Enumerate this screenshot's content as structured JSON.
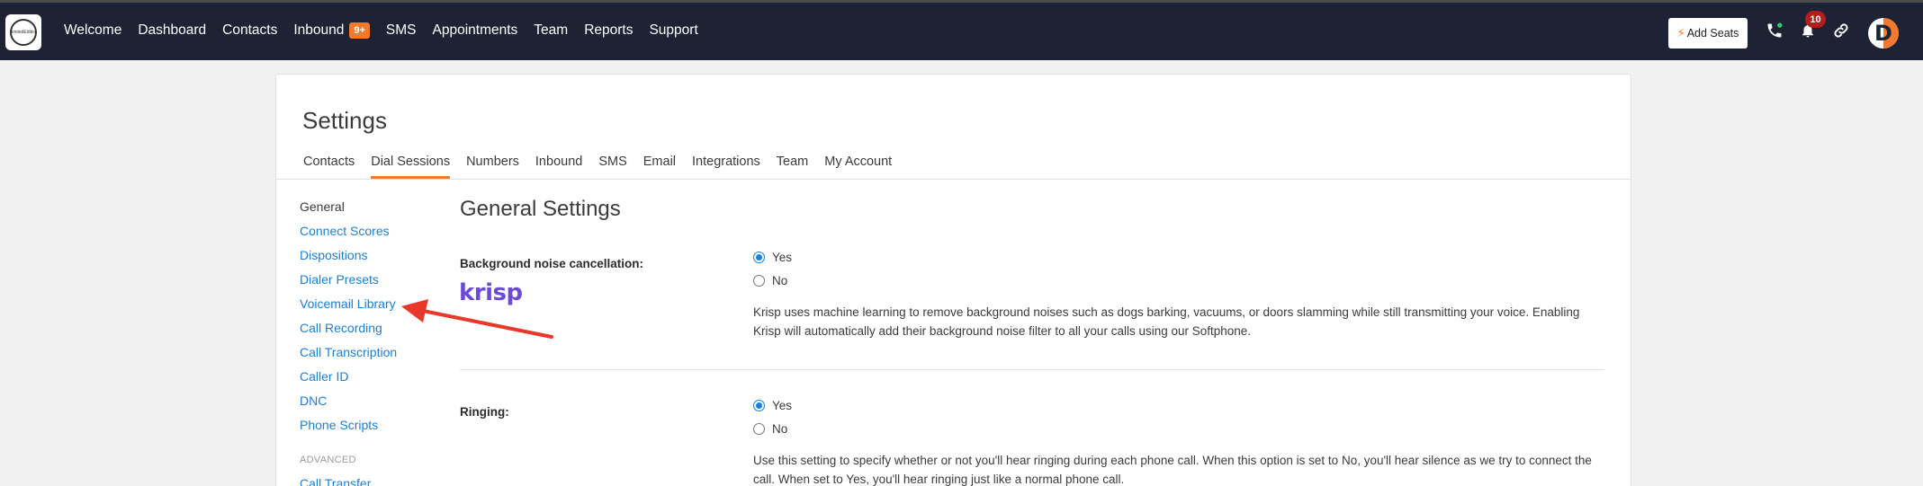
{
  "nav": {
    "logo_text": "LimitedEdition",
    "links": [
      {
        "label": "Welcome"
      },
      {
        "label": "Dashboard"
      },
      {
        "label": "Contacts"
      },
      {
        "label": "Inbound",
        "badge": "9+"
      },
      {
        "label": "SMS"
      },
      {
        "label": "Appointments"
      },
      {
        "label": "Team"
      },
      {
        "label": "Reports"
      },
      {
        "label": "Support"
      }
    ],
    "add_seats_label": "Add Seats",
    "notification_count": "10",
    "avatar_letter": "D",
    "icons": [
      "phone-icon",
      "bell-icon",
      "link-icon"
    ]
  },
  "settings": {
    "title": "Settings",
    "tabs": [
      {
        "label": "Contacts"
      },
      {
        "label": "Dial Sessions",
        "active": true
      },
      {
        "label": "Numbers"
      },
      {
        "label": "Inbound"
      },
      {
        "label": "SMS"
      },
      {
        "label": "Email"
      },
      {
        "label": "Integrations"
      },
      {
        "label": "Team"
      },
      {
        "label": "My Account"
      }
    ],
    "sidebar": {
      "items": [
        {
          "label": "General",
          "current": true
        },
        {
          "label": "Connect Scores"
        },
        {
          "label": "Dispositions"
        },
        {
          "label": "Dialer Presets"
        },
        {
          "label": "Voicemail Library"
        },
        {
          "label": "Call Recording"
        },
        {
          "label": "Call Transcription"
        },
        {
          "label": "Caller ID"
        },
        {
          "label": "DNC"
        },
        {
          "label": "Phone Scripts"
        }
      ],
      "advanced_heading": "ADVANCED",
      "advanced_items": [
        {
          "label": "Call Transfer"
        }
      ]
    },
    "section_title": "General Settings",
    "noise": {
      "label": "Background noise cancellation:",
      "brand": "krisp",
      "options": [
        "Yes",
        "No"
      ],
      "selected": "Yes",
      "description": "Krisp uses machine learning to remove background noises such as dogs barking, vacuums, or doors slamming while still transmitting your voice. Enabling Krisp will automatically add their background noise filter to all your calls using our Softphone."
    },
    "ringing": {
      "label": "Ringing:",
      "options": [
        "Yes",
        "No"
      ],
      "selected": "Yes",
      "description": "Use this setting to specify whether or not you'll hear ringing during each phone call. When this option is set to No, you'll hear silence as we try to connect the call. When set to Yes, you'll hear ringing just like a normal phone call."
    }
  },
  "colors": {
    "navbar": "#1e2235",
    "accent": "#f3792d",
    "link": "#1b7fd4",
    "annotation_arrow": "#e8382a",
    "krisp": "#6b4ad6"
  }
}
